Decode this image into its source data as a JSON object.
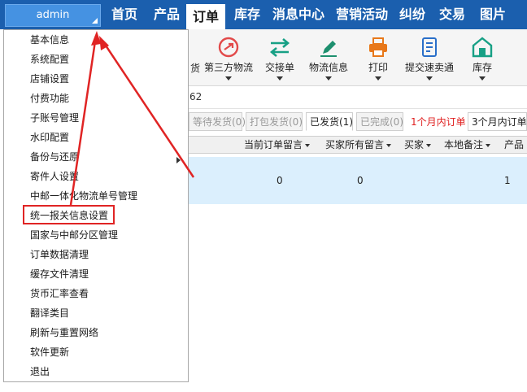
{
  "topbar": {
    "user": "admin",
    "nav": [
      "首页",
      "产品",
      "订单",
      "库存",
      "消息中心",
      "营销活动",
      "纠纷",
      "交易",
      "图片"
    ],
    "active_index": 2
  },
  "toolbar": {
    "partial_label": "货",
    "tools": [
      {
        "label": "第三方物流",
        "icon": "plane-circle-icon"
      },
      {
        "label": "交接单",
        "icon": "swap-arrows-icon"
      },
      {
        "label": "物流信息",
        "icon": "pen-icon"
      },
      {
        "label": "打印",
        "icon": "printer-icon"
      },
      {
        "label": "提交速卖通",
        "icon": "document-list-icon"
      },
      {
        "label": "库存",
        "icon": "warehouse-icon"
      }
    ]
  },
  "search": {
    "value": "62"
  },
  "tabs": {
    "items": [
      "等待发货(0)",
      "打包发货(0)",
      "已发货(1)",
      "已完成(0)"
    ],
    "active_index": 2,
    "red_link": "1个月内订单",
    "range_select": "3个月内订单"
  },
  "table": {
    "columns": [
      "当前订单留言",
      "买家所有留言",
      "买家",
      "本地备注",
      "产品"
    ],
    "row": [
      "0",
      "0",
      "1"
    ]
  },
  "menu": {
    "items": [
      "基本信息",
      "系统配置",
      "店铺设置",
      "付费功能",
      "子账号管理",
      "水印配置",
      "备份与还原",
      "寄件人设置",
      "中邮一体化物流单号管理",
      "统一报关信息设置",
      "国家与中邮分区管理",
      "订单数据清理",
      "缓存文件清理",
      "货币汇率查看",
      "翻译类目",
      "刷新与重置网络",
      "软件更新",
      "退出"
    ],
    "highlighted_index": 9,
    "submenu_index": 6
  },
  "colors": {
    "topbar": "#1b5fae",
    "accent": "#4592e2",
    "annotation": "#e02424",
    "row_selected": "#dbeffd",
    "toolbar_icons": "#e24a4a"
  }
}
